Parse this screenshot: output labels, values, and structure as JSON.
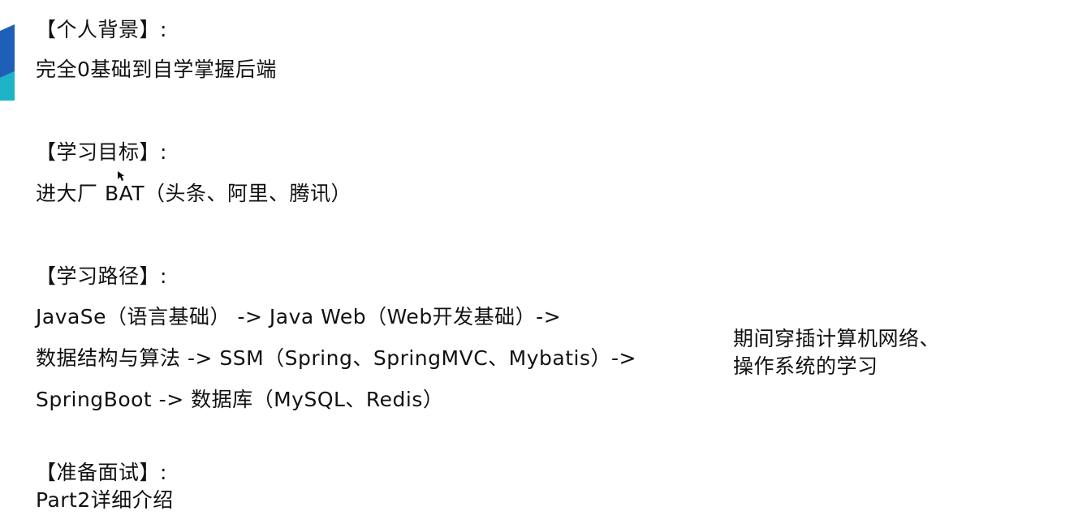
{
  "background": {
    "heading": "【个人背景】:",
    "text": "完全0基础到自学掌握后端"
  },
  "goal": {
    "heading": "【学习目标】:",
    "text": "进大厂 BAT（头条、阿里、腾讯）"
  },
  "path": {
    "heading": "【学习路径】:",
    "lines": [
      "JavaSe（语言基础） -> Java Web（Web开发基础）->",
      "数据结构与算法 -> SSM（Spring、SpringMVC、Mybatis）->",
      "SpringBoot -> 数据库（MySQL、Redis）"
    ],
    "note_lines": [
      "期间穿插计算机网络、",
      "操作系统的学习"
    ]
  },
  "interview": {
    "heading": "【准备面试】:",
    "text": "Part2详细介绍"
  },
  "colors": {
    "text": "#111111",
    "deco_blue": "#1f5fb8",
    "deco_teal": "#1fb3c9"
  },
  "icons": [
    "slide-accent-shape",
    "mouse-cursor-icon"
  ]
}
